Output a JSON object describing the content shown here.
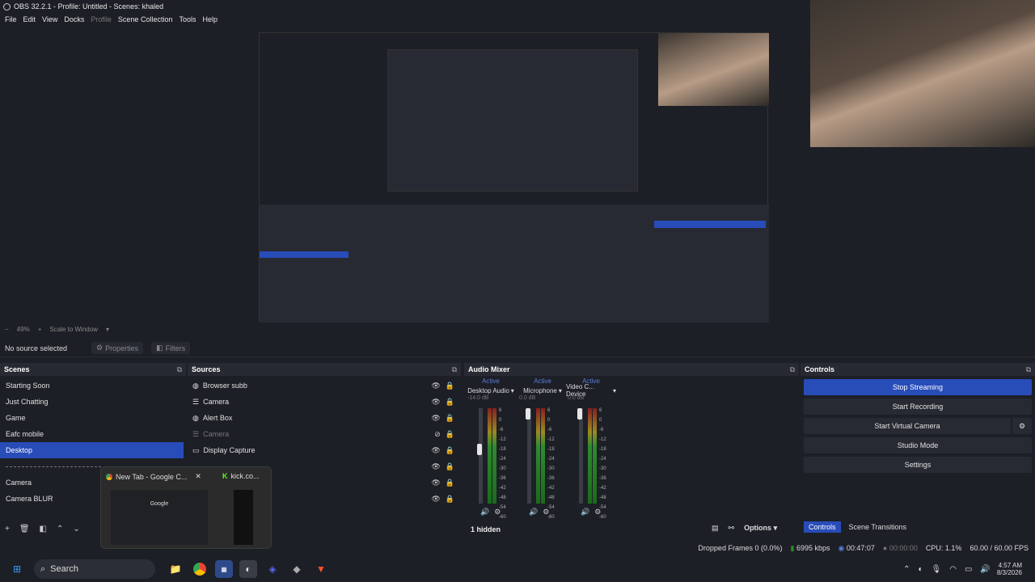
{
  "window": {
    "title": "OBS 32.2.1 - Profile: Untitled - Scenes: khaled"
  },
  "menu": [
    "File",
    "Edit",
    "View",
    "Docks",
    "Profile",
    "Scene Collection",
    "Tools",
    "Help"
  ],
  "zoom": {
    "level": "49%",
    "mode": "Scale to Window"
  },
  "context_bar": {
    "no_source": "No source selected",
    "properties": "Properties",
    "filters": "Filters"
  },
  "scenes": {
    "title": "Scenes",
    "items": [
      "Starting Soon",
      "Just Chatting",
      "Game",
      "Eafc mobile",
      "Desktop",
      "",
      "Camera",
      "Camera BLUR"
    ],
    "selected": "Desktop"
  },
  "sources": {
    "title": "Sources",
    "items": [
      {
        "label": "Browser subb",
        "icon": "globe-icon",
        "dim": false
      },
      {
        "label": "Camera",
        "icon": "list-icon",
        "dim": false
      },
      {
        "label": "Alert Box",
        "icon": "globe-icon",
        "dim": false
      },
      {
        "label": "Camera",
        "icon": "list-icon",
        "dim": true
      },
      {
        "label": "Display Capture",
        "icon": "monitor-icon",
        "dim": false
      }
    ]
  },
  "mixer": {
    "title": "Audio Mixer",
    "channels": [
      {
        "status": "Active",
        "name": "Desktop Audio",
        "db": "-14.0 dB",
        "level": 0.45
      },
      {
        "status": "Active",
        "name": "Microphone",
        "db": "0.0 dB",
        "level": 0.85
      },
      {
        "status": "Active",
        "name": "Video C... Device",
        "db": "0.0 dB",
        "level": 0.85
      }
    ],
    "ticks": [
      "6",
      "0",
      "-6",
      "-12",
      "-18",
      "-24",
      "-30",
      "-36",
      "-42",
      "-48",
      "-54",
      "-60"
    ],
    "hidden": "1 hidden",
    "options": "Options"
  },
  "controls": {
    "title": "Controls",
    "buttons": [
      "Stop Streaming",
      "Start Recording",
      "Start Virtual Camera",
      "Studio Mode",
      "Settings"
    ],
    "tabs": [
      "Controls",
      "Scene Transitions"
    ]
  },
  "status": {
    "dropped": "Dropped Frames 0 (0.0%)",
    "kbps": "6995 kbps",
    "stream_time": "00:47:07",
    "rec_time": "00:00:00",
    "cpu": "CPU: 1.1%",
    "fps": "60.00 / 60.00 FPS"
  },
  "taskbar": {
    "search": "Search",
    "time": "4:57 AM",
    "date": "8/3/2026"
  },
  "popup": {
    "tab1": "New Tab - Google C...",
    "tab2": "kick.co...",
    "google": "Google"
  }
}
